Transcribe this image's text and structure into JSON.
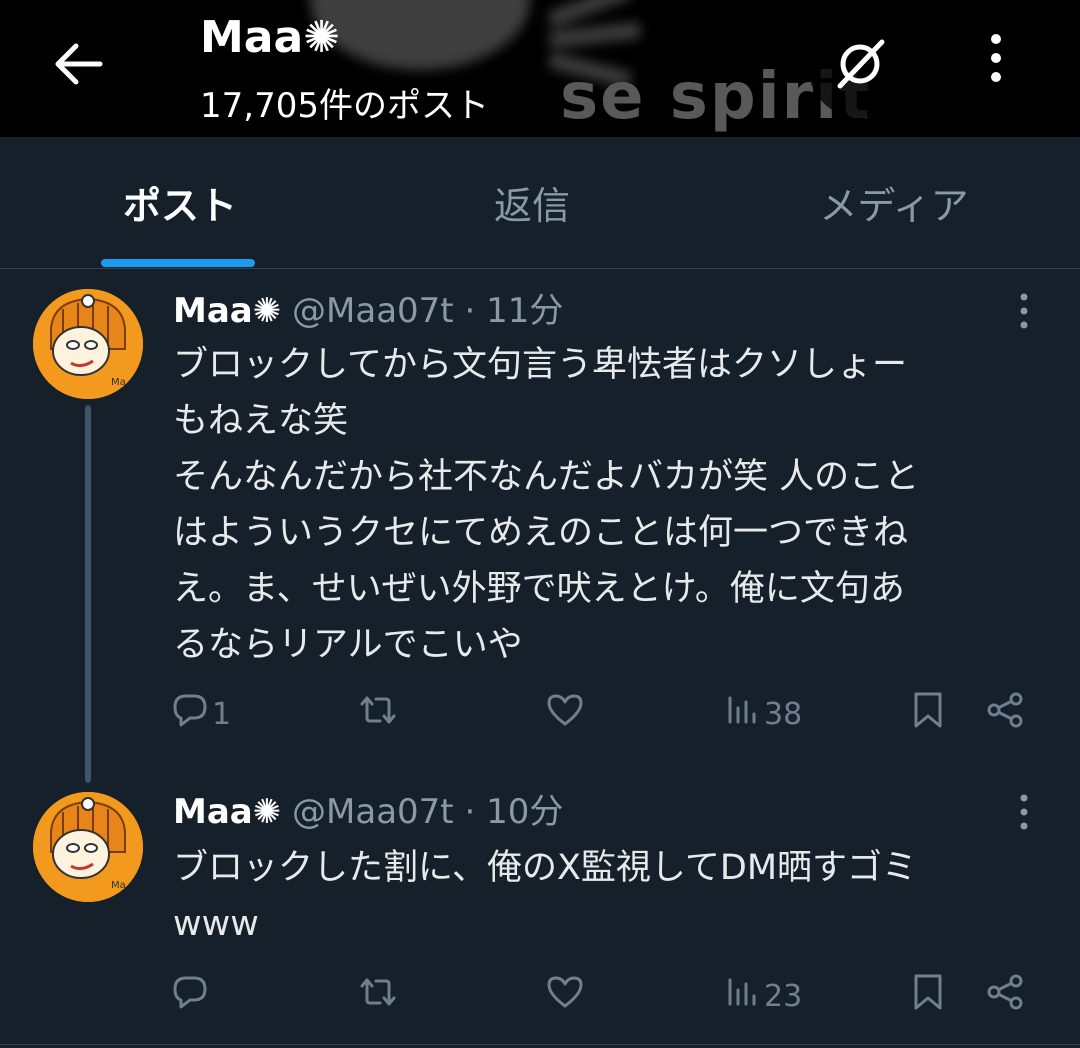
{
  "header": {
    "title": "Maa✺",
    "post_count": "17,705件のポスト",
    "banner_text": "se spirit"
  },
  "tabs": [
    {
      "label": "ポスト",
      "active": true
    },
    {
      "label": "返信",
      "active": false
    },
    {
      "label": "メディア",
      "active": false
    }
  ],
  "posts": [
    {
      "author": "Maa✺",
      "handle": "@Maa07t",
      "separator": "·",
      "time": "11分",
      "lines": [
        "ブロックしてから文句言う卑怯者はクソしょー",
        "もねえな笑",
        "そんなんだから社不なんだよバカが笑 人のこと",
        "はよういうクセにてめえのことは何一つできね",
        "え。ま、せいぜい外野で吠えとけ。俺に文句あ",
        "るならリアルでこいや"
      ],
      "reply_count": "1",
      "repost_count": "",
      "like_count": "",
      "view_count": "38"
    },
    {
      "author": "Maa✺",
      "handle": "@Maa07t",
      "separator": "·",
      "time": "10分",
      "lines": [
        "ブロックした割に、俺のX監視してDM晒すゴミ",
        "www"
      ],
      "reply_count": "",
      "repost_count": "",
      "like_count": "",
      "view_count": "23"
    }
  ],
  "colors": {
    "background": "#15202b",
    "accent": "#1d9bf0",
    "secondary_text": "#8b98a5",
    "avatar_bg": "#f39a1e"
  },
  "icons": [
    "back-arrow-icon",
    "grok-icon",
    "more-vertical-icon",
    "reply-icon",
    "repost-icon",
    "like-icon",
    "views-icon",
    "bookmark-icon",
    "share-icon"
  ]
}
